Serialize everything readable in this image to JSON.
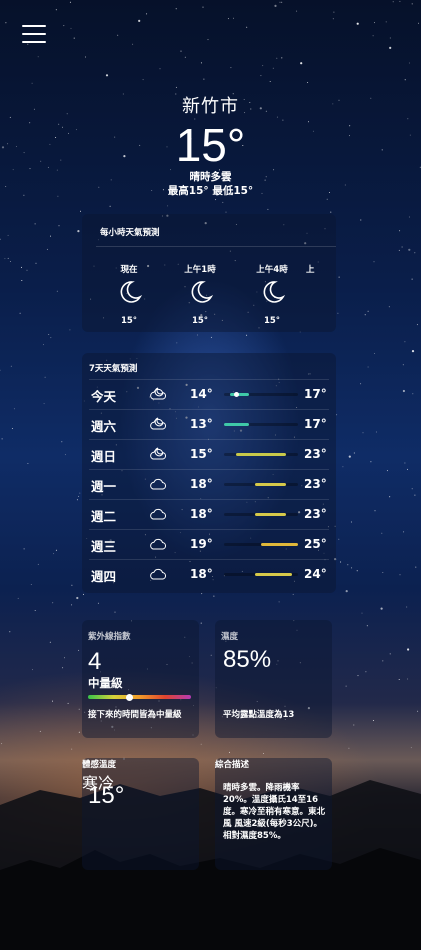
{
  "header": {
    "menu_icon": "hamburger-menu-icon",
    "city": "新竹市",
    "temperature": "15°",
    "condition": "晴時多雲",
    "high_low": "最高15° 最低15°"
  },
  "hourly": {
    "title": "每小時天氣預測",
    "items": [
      {
        "label": "現在",
        "icon": "crescent-moon-icon",
        "temp": "15°"
      },
      {
        "label": "上午1時",
        "icon": "crescent-moon-icon",
        "temp": "15°"
      },
      {
        "label": "上午4時",
        "icon": "crescent-moon-icon",
        "temp": "15°"
      },
      {
        "label": "上",
        "icon": "",
        "temp": ""
      }
    ]
  },
  "daily": {
    "title": "7天天氣預測",
    "range_min": 13,
    "range_max": 25,
    "days": [
      {
        "day": "今天",
        "icon": "cloud-moon-icon",
        "low": "14°",
        "high": "17°",
        "low_val": 14,
        "high_val": 17,
        "current": 15,
        "color": "#3fc9a8"
      },
      {
        "day": "週六",
        "icon": "cloud-moon-icon",
        "low": "13°",
        "high": "17°",
        "low_val": 13,
        "high_val": 17,
        "color": "#3fc9a8"
      },
      {
        "day": "週日",
        "icon": "cloud-moon-icon",
        "low": "15°",
        "high": "23°",
        "low_val": 15,
        "high_val": 23,
        "color": "#c8c94a"
      },
      {
        "day": "週一",
        "icon": "cloud-icon",
        "low": "18°",
        "high": "23°",
        "low_val": 18,
        "high_val": 23,
        "color": "#d6c94a"
      },
      {
        "day": "週二",
        "icon": "cloud-icon",
        "low": "18°",
        "high": "23°",
        "low_val": 18,
        "high_val": 23,
        "color": "#d6c94a"
      },
      {
        "day": "週三",
        "icon": "cloud-icon",
        "low": "19°",
        "high": "25°",
        "low_val": 19,
        "high_val": 25,
        "color": "#e0b83a"
      },
      {
        "day": "週四",
        "icon": "cloud-icon",
        "low": "18°",
        "high": "24°",
        "low_val": 18,
        "high_val": 24,
        "color": "#d6c94a"
      }
    ]
  },
  "uv": {
    "title": "紫外線指數",
    "value": "4",
    "level": "中量級",
    "index_fraction": 0.4,
    "note": "接下來的時間皆為中量級"
  },
  "humidity": {
    "title": "濕度",
    "value": "85%",
    "note": "平均露點溫度為13"
  },
  "feels_like": {
    "title": "體感溫度",
    "value": "15°",
    "note": "寒冷"
  },
  "description": {
    "title": "綜合描述",
    "body": "晴時多雲。降雨機率20%。溫度攝氏14至16度。寒冷至稍有寒意。東北風 風速2級(每秒3公尺)。相對濕度85%。"
  }
}
